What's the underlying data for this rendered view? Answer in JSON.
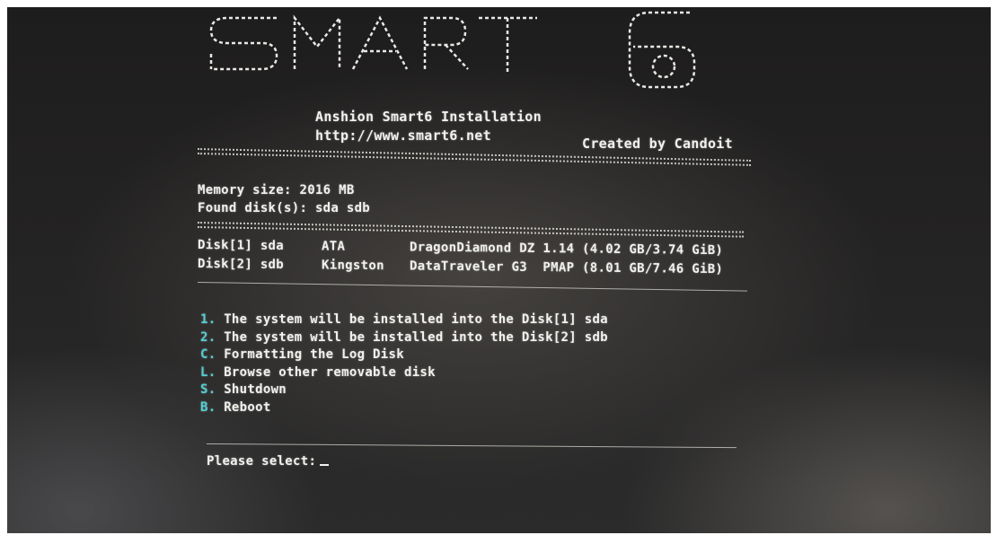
{
  "header": {
    "title": "Anshion Smart6 Installation",
    "url": "http://www.smart6.net",
    "credit": "Created by Candoit"
  },
  "system": {
    "memory_label": "Memory size:",
    "memory_value": "2016 MB",
    "disks_label": "Found disk(s):",
    "disks_value": "sda sdb"
  },
  "disks": [
    {
      "id": "Disk[1] sda",
      "vendor": "ATA",
      "model": "DragonDiamond DZ 1.14 (4.02 GB/3.74 GiB)"
    },
    {
      "id": "Disk[2] sdb",
      "vendor": "Kingston",
      "model": "DataTraveler G3  PMAP (8.01 GB/7.46 GiB)"
    }
  ],
  "menu": [
    {
      "key": "1.",
      "label": "The system will be installed into the Disk[1] sda"
    },
    {
      "key": "2.",
      "label": "The system will be installed into the Disk[2] sdb"
    },
    {
      "key": "C.",
      "label": "Formatting the Log Disk"
    },
    {
      "key": "L.",
      "label": "Browse other removable disk"
    },
    {
      "key": "S.",
      "label": "Shutdown"
    },
    {
      "key": "B.",
      "label": "Reboot"
    }
  ],
  "prompt": {
    "label": "Please select:",
    "value": ""
  },
  "colors": {
    "text": "#f1f1ee",
    "key": "#4fd0d6",
    "background": "#222121"
  },
  "logo": {
    "text": "SMART 6"
  }
}
